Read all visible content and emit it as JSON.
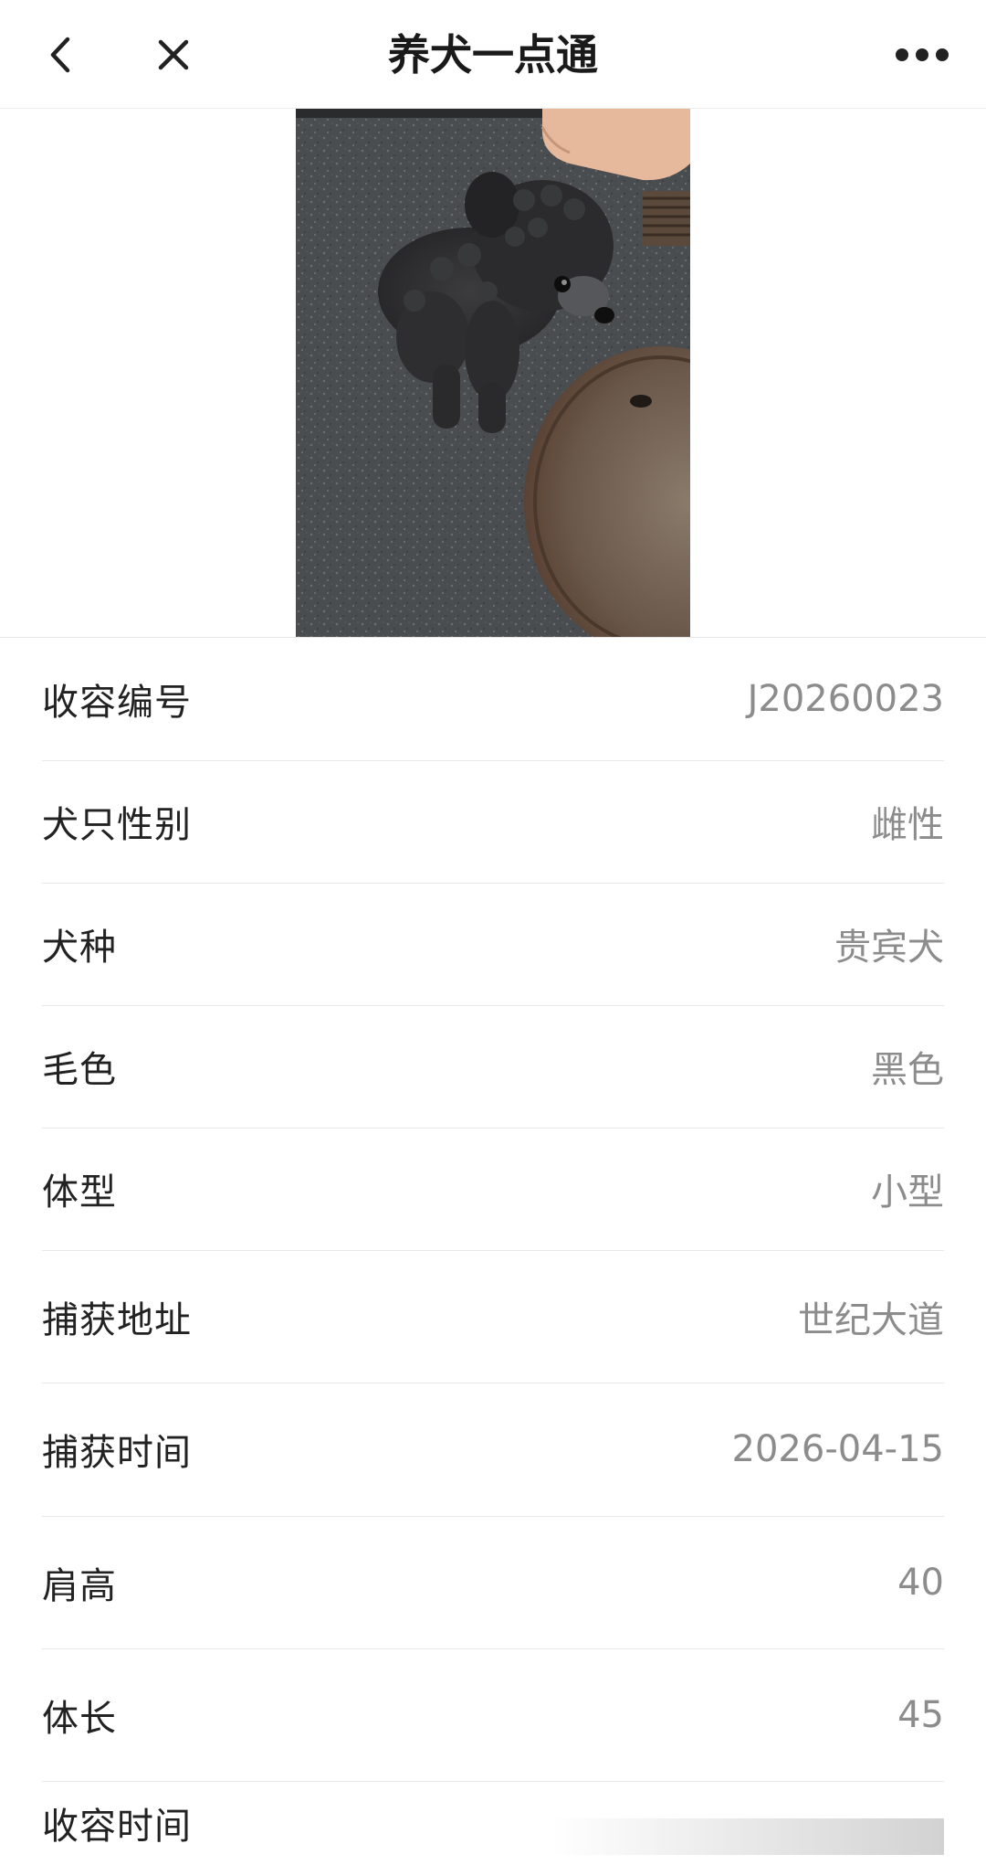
{
  "header": {
    "title": "养犬一点通",
    "back_icon": "chevron-left-icon",
    "close_icon": "close-icon",
    "more_icon": "more-dots-icon"
  },
  "photo": {
    "subject": "dog-photo"
  },
  "info": {
    "rows": [
      {
        "label": "收容编号",
        "value": "J20260023"
      },
      {
        "label": "犬只性别",
        "value": "雌性"
      },
      {
        "label": "犬种",
        "value": "贵宾犬"
      },
      {
        "label": "毛色",
        "value": "黑色"
      },
      {
        "label": "体型",
        "value": "小型"
      },
      {
        "label": "捕获地址",
        "value": "世纪大道"
      },
      {
        "label": "捕获时间",
        "value": "2026-04-15"
      },
      {
        "label": "肩高",
        "value": "40"
      },
      {
        "label": "体长",
        "value": "45"
      },
      {
        "label": "收容时间",
        "value": ""
      }
    ]
  },
  "colors": {
    "title_text": "#1a1a1a",
    "label_text": "#222222",
    "value_text": "#8c8c8c",
    "divider": "#e8e8e8"
  }
}
